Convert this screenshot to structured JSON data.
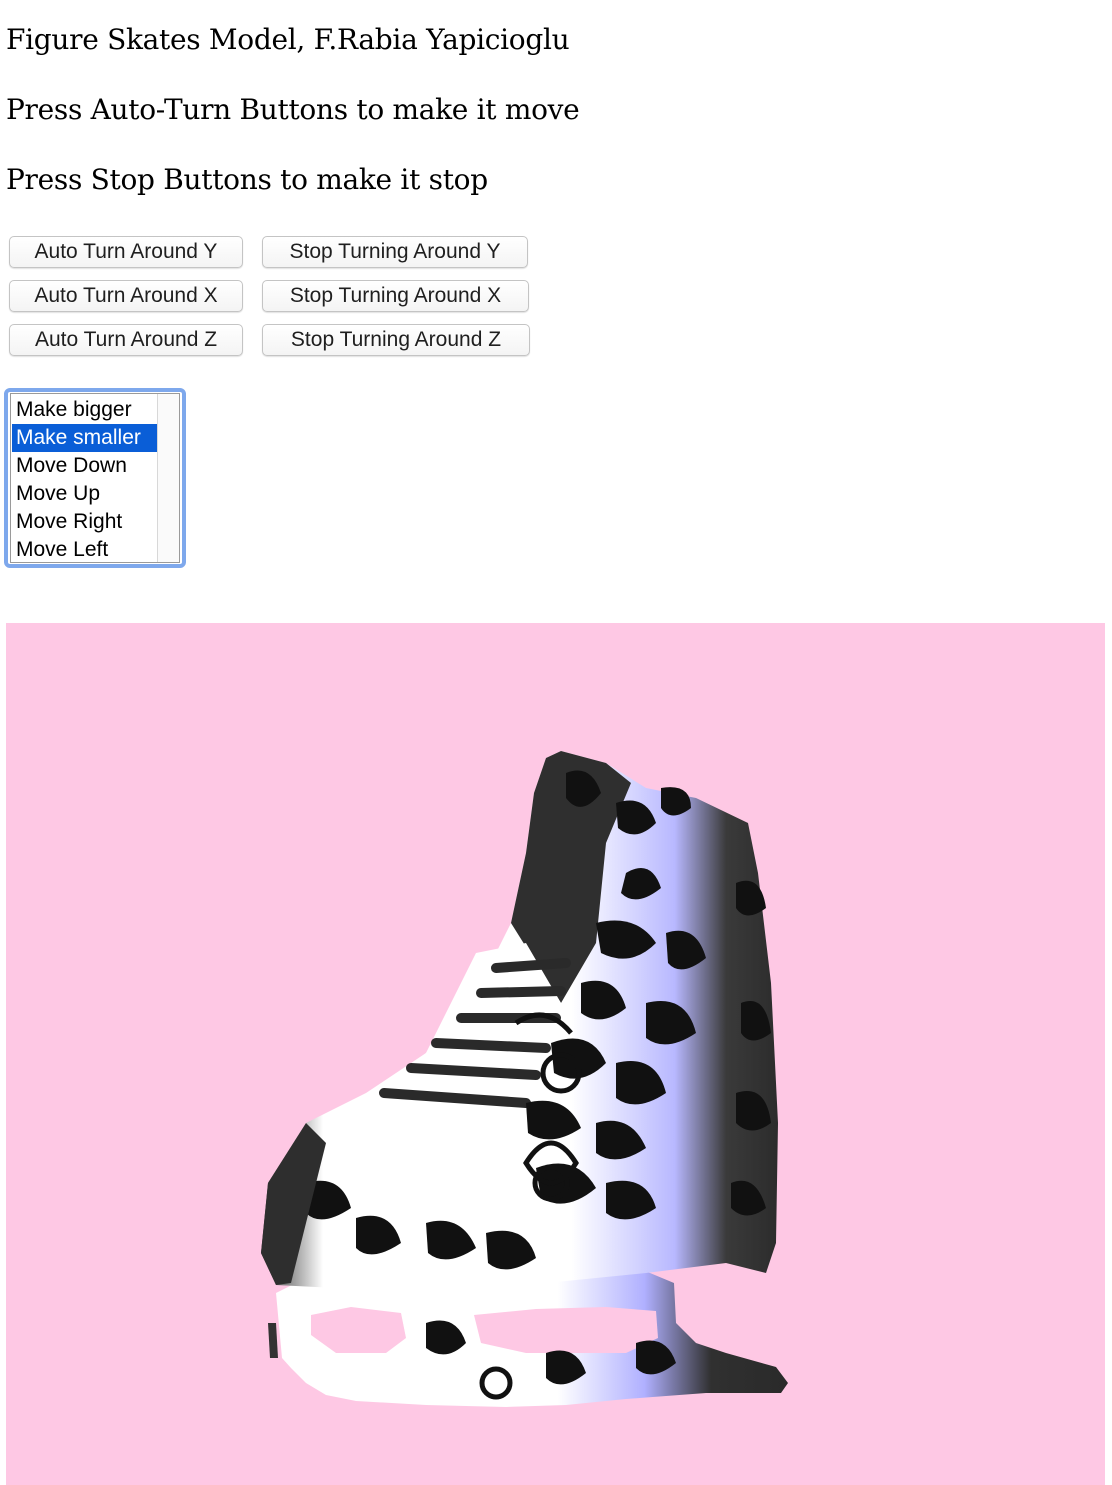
{
  "headings": {
    "title": "Figure Skates Model, F.Rabia Yapicioglu",
    "instruction_move": "Press Auto-Turn Buttons to make it move",
    "instruction_stop": "Press Stop Buttons to make it stop"
  },
  "buttons": {
    "auto_y": "Auto Turn Around Y",
    "stop_y": "Stop Turning Around Y",
    "auto_x": "Auto Turn Around X",
    "stop_x": "Stop Turning Around X",
    "auto_z": "Auto Turn Around Z",
    "stop_z": "Stop Turning Around Z"
  },
  "listbox": {
    "options": [
      "Make bigger",
      "Make smaller",
      "Move Down",
      "Move Up",
      "Move Right",
      "Move Left"
    ],
    "selected": "Make smaller"
  },
  "canvas": {
    "background_color": "#fec8e4",
    "model": "figure-skate-3d-model"
  },
  "colors": {
    "focus_ring": "#7ea8ec",
    "selection": "#0a5ed7"
  }
}
